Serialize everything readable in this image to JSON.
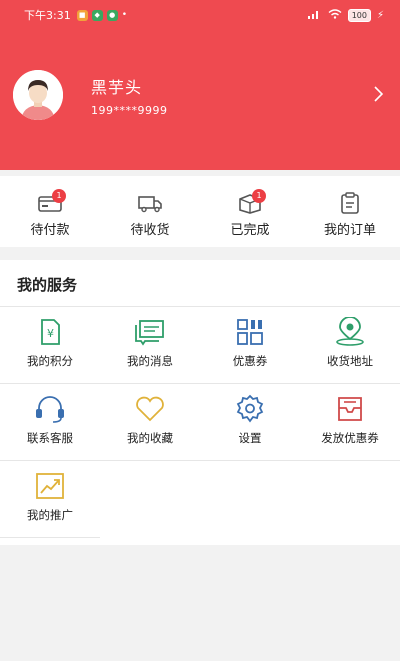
{
  "status_bar": {
    "time": "下午3:31",
    "battery": "100"
  },
  "profile": {
    "name": "黑芋头",
    "phone": "199****9999"
  },
  "orders": [
    {
      "label": "待付款",
      "badge": "1"
    },
    {
      "label": "待收货",
      "badge": ""
    },
    {
      "label": "已完成",
      "badge": "1"
    },
    {
      "label": "我的订单",
      "badge": ""
    }
  ],
  "services": {
    "title": "我的服务",
    "items": [
      {
        "label": "我的积分",
        "icon": "points-icon"
      },
      {
        "label": "我的消息",
        "icon": "message-icon"
      },
      {
        "label": "优惠券",
        "icon": "coupon-icon"
      },
      {
        "label": "收货地址",
        "icon": "location-icon"
      },
      {
        "label": "联系客服",
        "icon": "headset-icon"
      },
      {
        "label": "我的收藏",
        "icon": "heart-icon"
      },
      {
        "label": "设置",
        "icon": "gear-icon"
      },
      {
        "label": "发放优惠券",
        "icon": "inbox-icon"
      },
      {
        "label": "我的推广",
        "icon": "promotion-icon"
      }
    ]
  },
  "colors": {
    "brand": "#ef4a50",
    "green": "#2e9e6a",
    "blue": "#3a6fb0",
    "gold": "#e0b23a",
    "red": "#d04a4a"
  }
}
